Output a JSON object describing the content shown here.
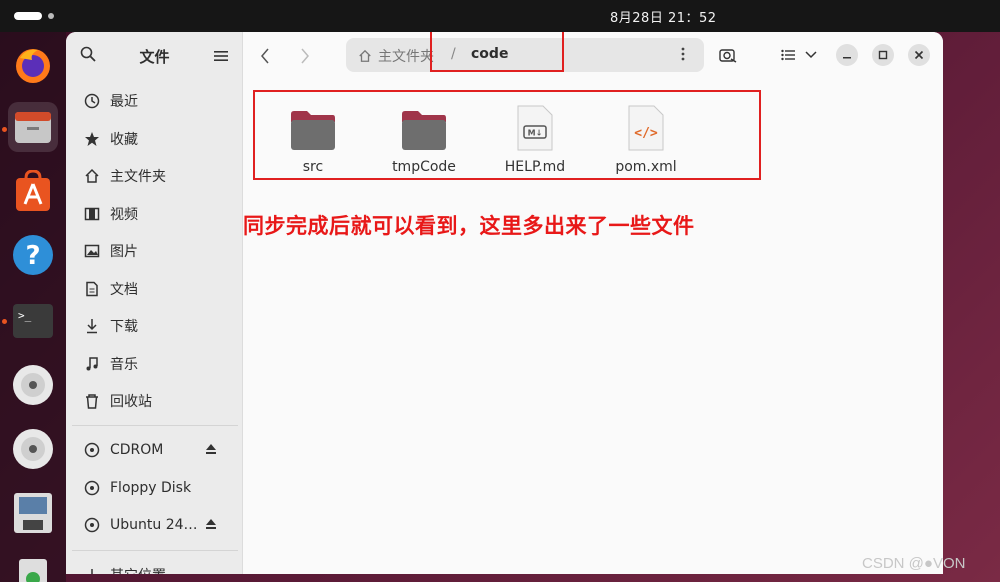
{
  "topbar": {
    "clock": "8月28日  21：52"
  },
  "dock": {
    "items": [
      {
        "name": "firefox-icon"
      },
      {
        "name": "files-icon"
      },
      {
        "name": "app-center-icon"
      },
      {
        "name": "help-icon"
      },
      {
        "name": "terminal-icon"
      },
      {
        "name": "cdrom-icon"
      },
      {
        "name": "cdrom-icon"
      },
      {
        "name": "floppy-icon"
      },
      {
        "name": "trash-icon"
      }
    ]
  },
  "sidebar": {
    "title": "文件",
    "places": [
      {
        "label": "最近",
        "icon": "clock-icon"
      },
      {
        "label": "收藏",
        "icon": "star-icon"
      },
      {
        "label": "主文件夹",
        "icon": "home-icon"
      },
      {
        "label": "视频",
        "icon": "film-icon"
      },
      {
        "label": "图片",
        "icon": "image-icon"
      },
      {
        "label": "文档",
        "icon": "document-icon"
      },
      {
        "label": "下载",
        "icon": "download-icon"
      },
      {
        "label": "音乐",
        "icon": "music-icon"
      },
      {
        "label": "回收站",
        "icon": "trash-icon"
      }
    ],
    "devices": [
      {
        "label": "CDROM",
        "icon": "disc-icon",
        "eject": true
      },
      {
        "label": "Floppy Disk",
        "icon": "disc-icon",
        "eject": false
      },
      {
        "label": "Ubuntu 24…",
        "icon": "disc-icon",
        "eject": true
      }
    ],
    "other": "其它位置"
  },
  "pathbar": {
    "home": "主文件夹",
    "separator": "/",
    "current": "code"
  },
  "files": [
    {
      "name": "src",
      "type": "folder"
    },
    {
      "name": "tmpCode",
      "type": "folder"
    },
    {
      "name": "HELP.md",
      "type": "markdown"
    },
    {
      "name": "pom.xml",
      "type": "xml"
    }
  ],
  "annotation": "同步完成后就可以看到，这里多出来了一些文件",
  "watermark": "CSDN @●VON",
  "colors": {
    "accent": "#e95420",
    "annotation": "#e81818",
    "folder": "#6e6e6e",
    "folder_tab": "#a0354a"
  }
}
